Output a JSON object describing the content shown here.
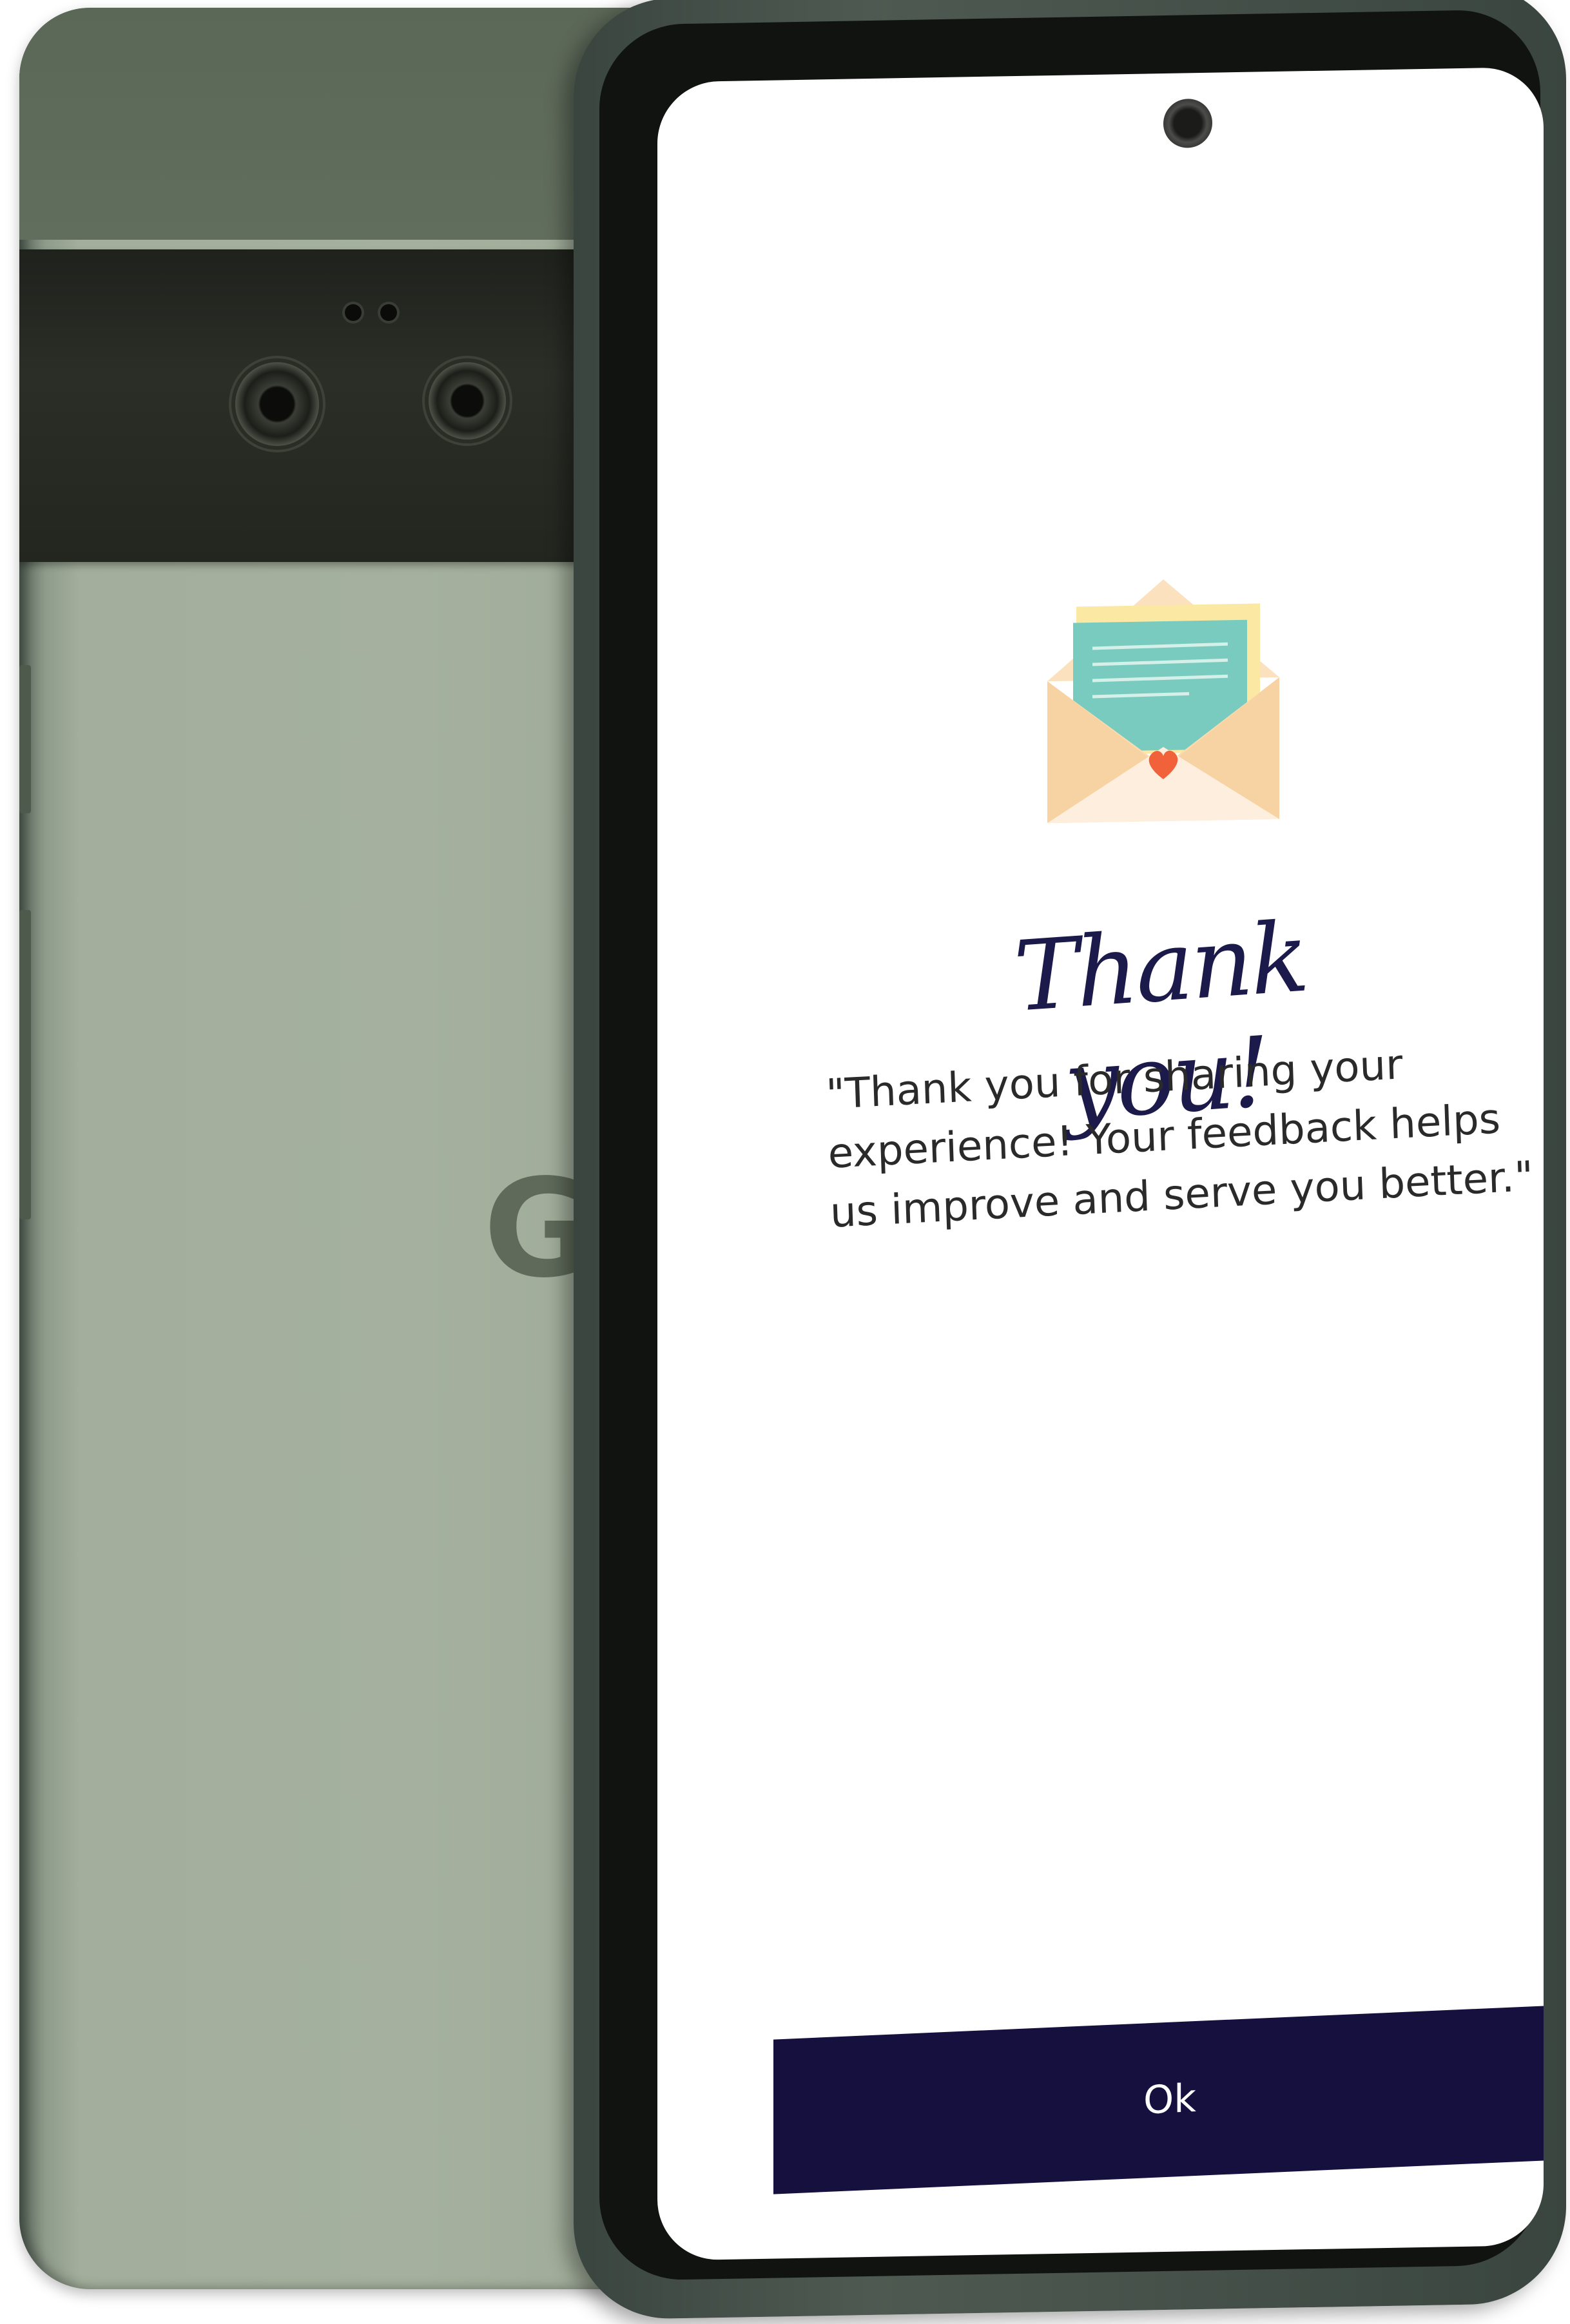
{
  "back_phone": {
    "logo_letter": "G"
  },
  "screen": {
    "illustration": "envelope-with-letter-and-heart",
    "title": "Thank you!",
    "message": "\"Thank you for sharing your experience! Your feedback helps us improve and serve you better.\"",
    "ok_button_label": "Ok"
  },
  "colors": {
    "button_bg": "#16103f",
    "title": "#1c1a4a",
    "envelope": "#f9dcb0",
    "letter": "#79cbbf",
    "heart": "#f1623a"
  }
}
